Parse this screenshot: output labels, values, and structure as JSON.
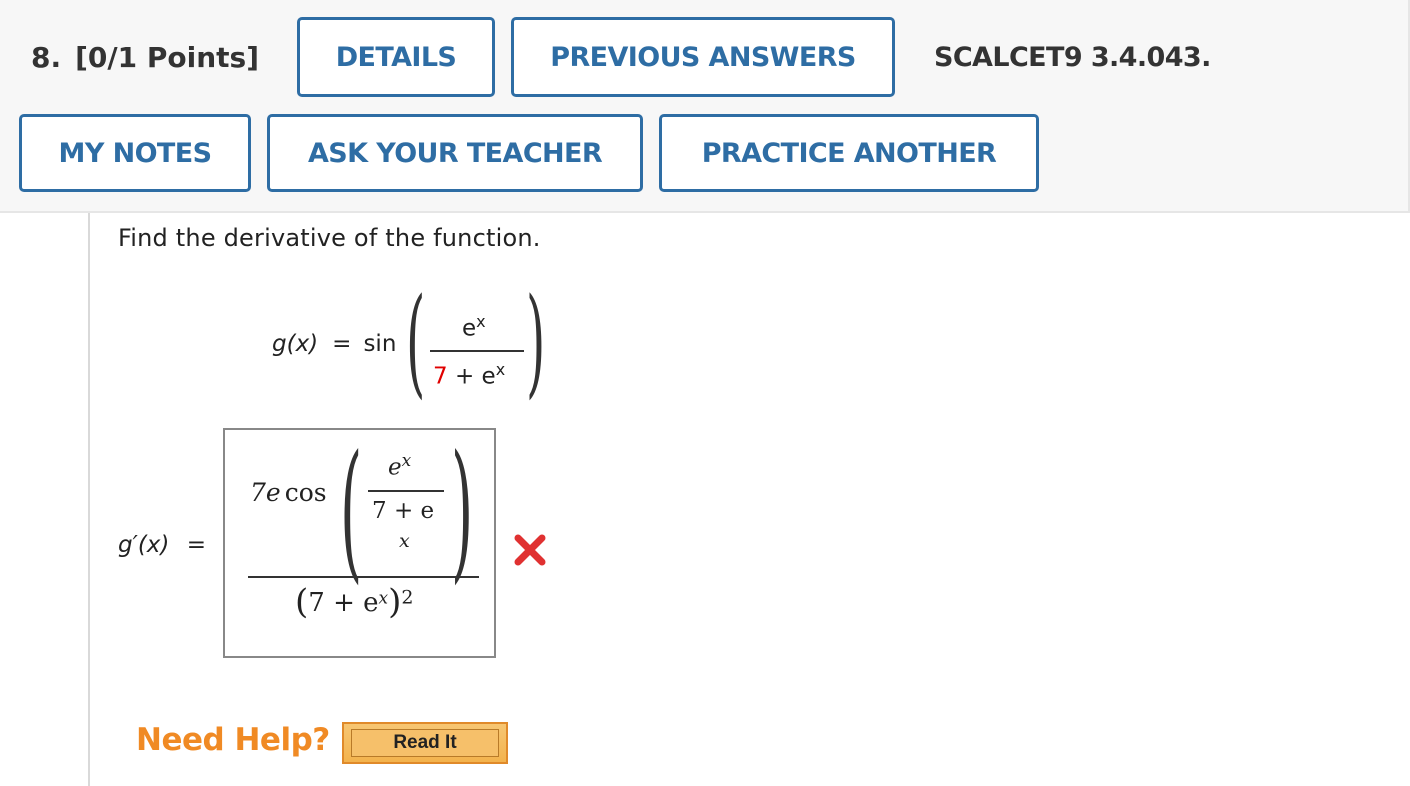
{
  "question": {
    "number": "8.",
    "points": "[0/1 Points]",
    "source": "SCALCET9 3.4.043."
  },
  "buttons": {
    "details": "DETAILS",
    "previous_answers": "PREVIOUS ANSWERS",
    "my_notes": "MY NOTES",
    "ask_teacher": "ASK YOUR TEACHER",
    "practice_another": "PRACTICE ANOTHER"
  },
  "problem": {
    "prompt": "Find the derivative of the function.",
    "function": {
      "lhs": "g(x)",
      "equals": "=",
      "func": "sin",
      "numerator": "e",
      "numerator_exp": "x",
      "denominator_const": "7",
      "denominator_rest": "+ e",
      "denominator_exp": "x"
    }
  },
  "answer": {
    "label": "g′(x)",
    "equals": "=",
    "entered": {
      "coef": "7e",
      "func": "cos",
      "inner_num": "e",
      "inner_num_exp": "x",
      "inner_den": "7 + e",
      "inner_den_below": "x",
      "denom_open": "(",
      "denom_inner": "7 + e",
      "denom_inner_exp": "x",
      "denom_close": ")",
      "denom_power": "2"
    },
    "status": "incorrect",
    "status_icon": "x-mark-icon",
    "status_color": "#e03131"
  },
  "help": {
    "label": "Need Help?",
    "read_it": "Read It"
  },
  "colors": {
    "accent": "#2e6da4",
    "help_orange": "#f08a24",
    "highlight_red": "#e00000"
  }
}
